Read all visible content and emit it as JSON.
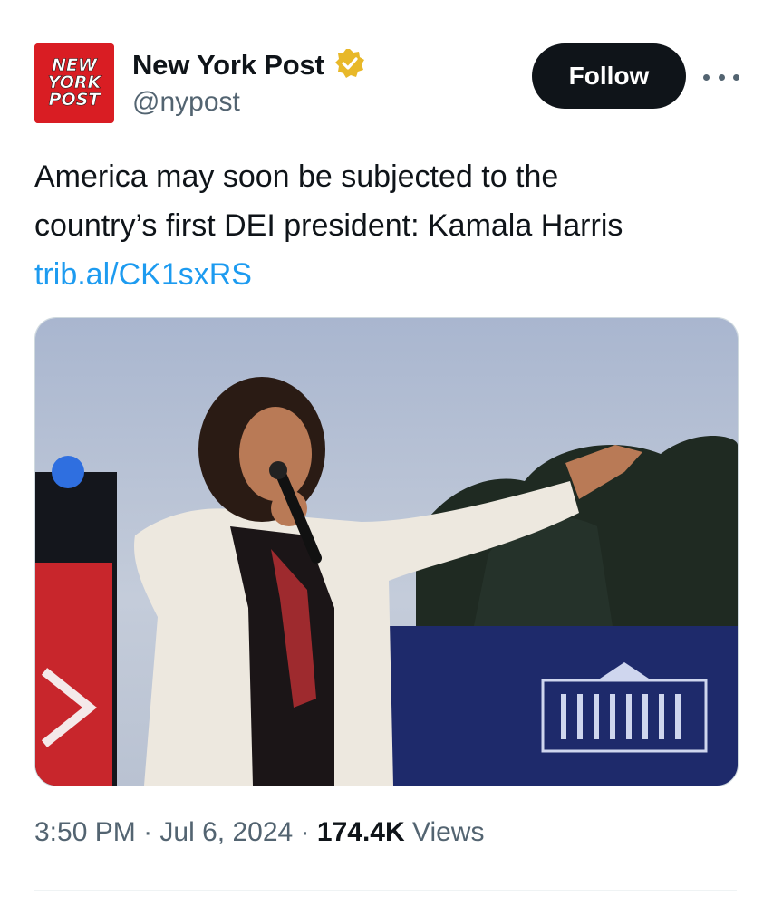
{
  "account": {
    "logo_text": [
      "NEW",
      "YORK",
      "POST"
    ],
    "display_name": "New York Post",
    "handle": "@nypost",
    "verified_icon": "gold-verified-badge-icon"
  },
  "actions": {
    "follow_label": "Follow",
    "more_icon": "more-horizontal-icon"
  },
  "tweet": {
    "text_line1": "America may soon be subjected to the",
    "text_line2": "country’s first DEI president: Kamala Harris",
    "link": "trib.al/CK1sxRS"
  },
  "media": {
    "type": "photo",
    "icon": "photo-of-speaker-with-microphone"
  },
  "meta": {
    "time": "3:50 PM",
    "separator": "·",
    "date": "Jul 6, 2024",
    "views_count": "174.4K",
    "views_label": "Views"
  },
  "colors": {
    "brand_red": "#d91d23",
    "link_blue": "#1d9bf0",
    "button_dark": "#0f1419",
    "muted_gray": "#536471",
    "verified_gold": "#e8b829"
  }
}
